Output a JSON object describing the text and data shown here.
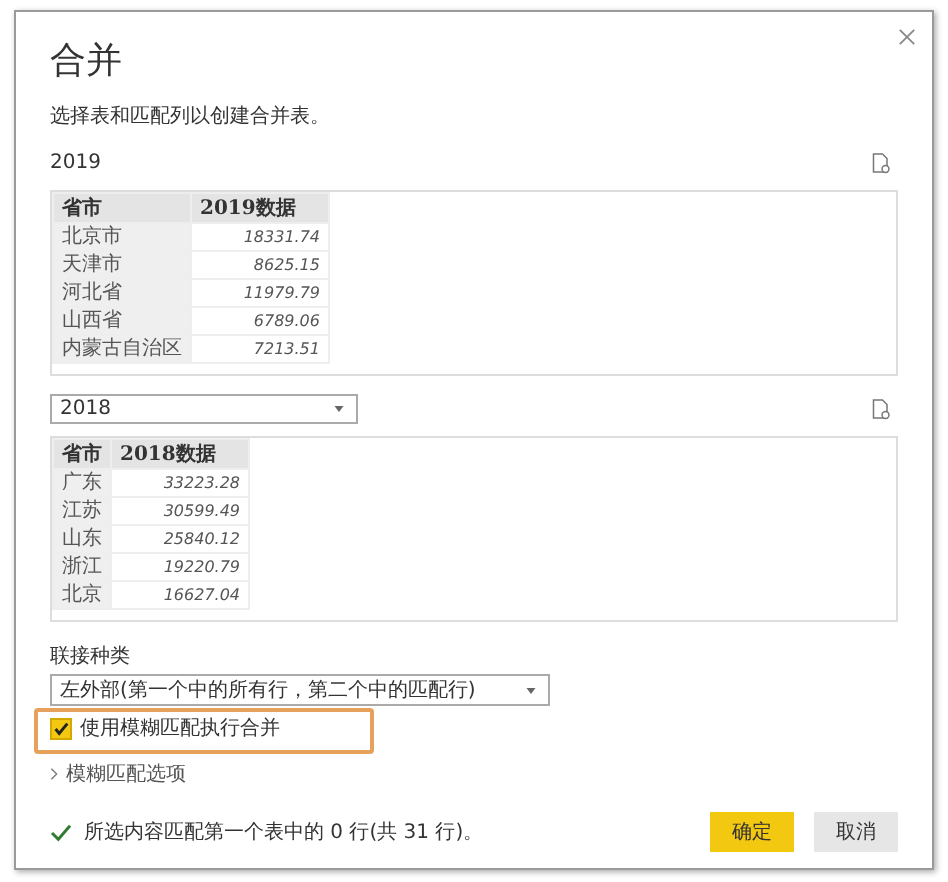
{
  "dialog": {
    "title": "合并",
    "description": "选择表和匹配列以创建合并表。"
  },
  "tables": [
    {
      "kind": "label",
      "source": "2019",
      "columns": [
        "省市",
        "2019数据"
      ],
      "rows": [
        [
          "北京市",
          "18331.74"
        ],
        [
          "天津市",
          "8625.15"
        ],
        [
          "河北省",
          "11979.79"
        ],
        [
          "山西省",
          "6789.06"
        ],
        [
          "内蒙古自治区",
          "7213.51"
        ]
      ]
    },
    {
      "kind": "dropdown",
      "source": "2018",
      "columns": [
        "省市",
        "2018数据"
      ],
      "rows": [
        [
          "广东",
          "33223.28"
        ],
        [
          "江苏",
          "30599.49"
        ],
        [
          "山东",
          "25840.12"
        ],
        [
          "浙江",
          "19220.79"
        ],
        [
          "北京",
          "16627.04"
        ]
      ]
    }
  ],
  "join": {
    "label": "联接种类",
    "value": "左外部(第一个中的所有行，第二个中的匹配行)"
  },
  "fuzzy": {
    "label": "使用模糊匹配执行合并",
    "checked": true,
    "highlighted": true
  },
  "fuzzy_options": {
    "label": "模糊匹配选项",
    "expanded": false
  },
  "status": "所选内容匹配第一个表中的 0 行(共 31 行)。",
  "buttons": [
    {
      "label": "确定",
      "kind": "primary"
    },
    {
      "label": "取消",
      "kind": "secondary"
    }
  ]
}
